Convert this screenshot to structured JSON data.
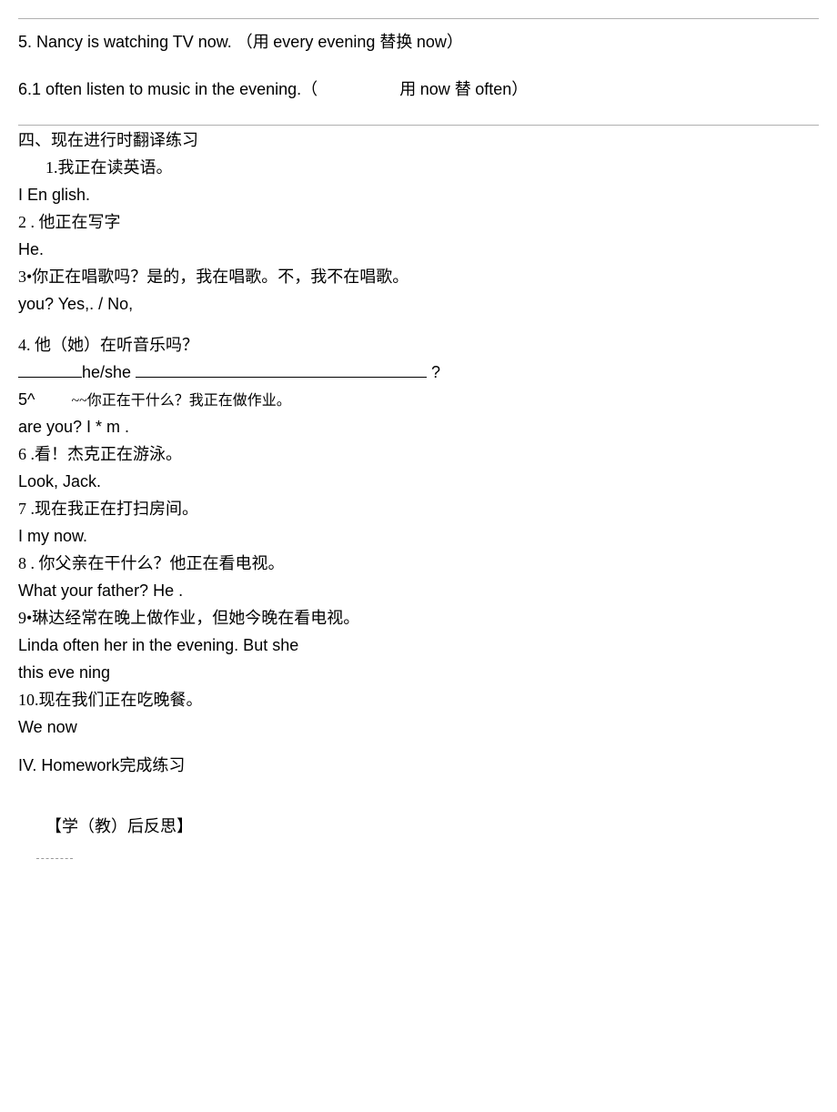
{
  "q5": {
    "text_en1": "5. Nancy is watching TV now. ",
    "text_cn1": "（用 ",
    "text_en2": "every evening ",
    "text_cn2": "替换 ",
    "text_en3": "now）"
  },
  "q6": {
    "text_en1": "6.1 often listen to music in the evening.（",
    "text_cn1": "用 ",
    "text_en2": "now ",
    "text_cn2": "替 ",
    "text_en3": "often）"
  },
  "section4_title": "四、现在进行时翻译练习",
  "t1": {
    "cn": "1.我正在读英语。",
    "en": "I En glish."
  },
  "t2": {
    "cn": "2 . 他正在写字",
    "en": "He."
  },
  "t3": {
    "cn": "3•你正在唱歌吗？是的，我在唱歌。不，我不在唱歌。",
    "en": " you? Yes,. / No,"
  },
  "t4": {
    "cn": "4. 他（她）在听音乐吗？",
    "en_mid": "he/she ",
    "en_q": " ?"
  },
  "t5": {
    "label": "5^",
    "cn": "~~你正在干什么？我正在做作业。",
    "en": " are you? I * m ."
  },
  "t6": {
    "cn": "6 .看！杰克正在游泳。",
    "en": "Look, Jack."
  },
  "t7": {
    "cn": "7 .现在我正在打扫房间。",
    "en": "I my now."
  },
  "t8": {
    "cn": "8 . 你父亲在干什么？他正在看电视。",
    "en": "What your father? He ."
  },
  "t9": {
    "cn": "9•琳达经常在晚上做作业，但她今晚在看电视。",
    "en1": "Linda often her in the evening. But she",
    "en2": "this eve ning"
  },
  "t10": {
    "cn": "10.现在我们正在吃晚餐。",
    "en": "We now"
  },
  "homework": "IV. Homework完成练习",
  "reflection": "【学（教）后反思】"
}
